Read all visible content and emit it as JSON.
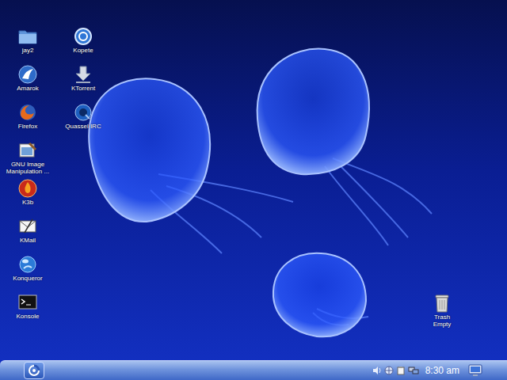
{
  "desktop": {
    "columns": [
      [
        {
          "label": "jay2"
        },
        {
          "label": "Amarok"
        },
        {
          "label": "Firefox"
        },
        {
          "label": "GNU Image Manipulation ..."
        },
        {
          "label": "K3b"
        },
        {
          "label": "KMail"
        },
        {
          "label": "Konqueror"
        },
        {
          "label": "Konsole"
        }
      ],
      [
        {
          "label": "Kopete"
        },
        {
          "label": "KTorrent"
        },
        {
          "label": "Quassel IRC"
        }
      ]
    ],
    "trash": {
      "label": "Trash",
      "status": "Empty"
    }
  },
  "taskbar": {
    "clock": "8:30 am"
  }
}
